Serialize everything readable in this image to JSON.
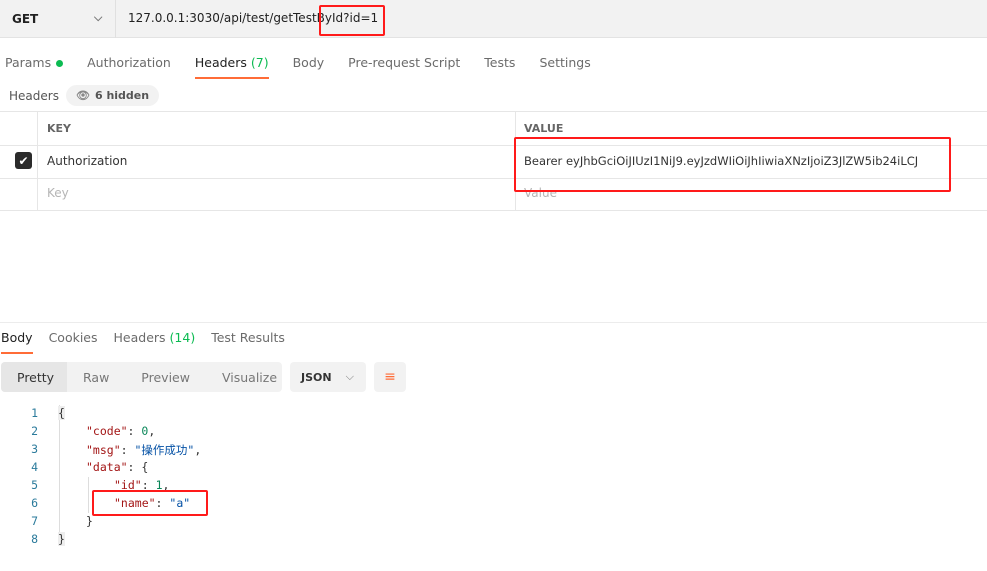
{
  "request": {
    "method": "GET",
    "url": "127.0.0.1:3030/api/test/getTestById?id=1",
    "tabs": [
      {
        "label": "Params",
        "dot": true
      },
      {
        "label": "Authorization"
      },
      {
        "label": "Headers",
        "count": "(7)",
        "active": true
      },
      {
        "label": "Body"
      },
      {
        "label": "Pre-request Script"
      },
      {
        "label": "Tests"
      },
      {
        "label": "Settings"
      }
    ],
    "headers_label": "Headers",
    "hidden_label": "6 hidden",
    "table": {
      "key_header": "KEY",
      "value_header": "VALUE",
      "rows": [
        {
          "checked": true,
          "key": "Authorization",
          "value": "Bearer eyJhbGciOiJIUzI1NiJ9.eyJzdWIiOiJhIiwiaXNzIjoiZ3JlZW5ib24iLCJ"
        }
      ],
      "key_placeholder": "Key",
      "value_placeholder": "Value"
    }
  },
  "response": {
    "tabs": [
      {
        "label": "Body",
        "active": true
      },
      {
        "label": "Cookies"
      },
      {
        "label": "Headers",
        "count": "(14)"
      },
      {
        "label": "Test Results"
      }
    ],
    "views": [
      "Pretty",
      "Raw",
      "Preview",
      "Visualize"
    ],
    "format": "JSON",
    "line_numbers": [
      "1",
      "2",
      "3",
      "4",
      "5",
      "6",
      "7",
      "8"
    ],
    "body": {
      "code_key": "\"code\"",
      "code_val": "0",
      "msg_key": "\"msg\"",
      "msg_val": "\"操作成功\"",
      "data_key": "\"data\"",
      "id_key": "\"id\"",
      "id_val": "1",
      "name_key": "\"name\"",
      "name_val": "\"a\""
    }
  },
  "colors": {
    "accent": "#ff6c37",
    "success": "#0cbb52",
    "highlight": "#ff1a1a"
  }
}
